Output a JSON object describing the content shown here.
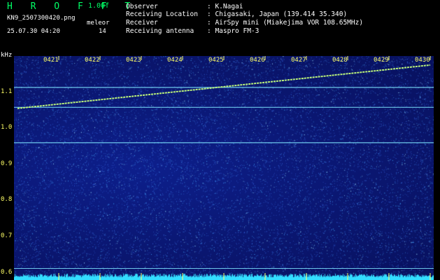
{
  "header": {
    "title": "H R O F F T",
    "version": "1.00f",
    "filename": "KN9_2507300420.png",
    "mode": "meleor",
    "datetime": "25.07.30 04:20",
    "count": "14",
    "info": [
      {
        "label": "Observer",
        "value": ": K.Nagai"
      },
      {
        "label": "Receiving Location",
        "value": ": Chigasaki, Japan (139.414 35.340)"
      },
      {
        "label": "Receiver",
        "value": ": AirSpy mini (Miakejima VOR 108.65MHz)"
      },
      {
        "label": "Receiving antenna",
        "value": ": Maspro FM-3"
      }
    ]
  },
  "colors": {
    "background": "#0a1670",
    "label_yellow": "#ffff66",
    "title_green": "#00ff66",
    "carrier_line": "#7fe6ff",
    "noise_floor": "#33ddff"
  },
  "chart_data": {
    "type": "heatmap",
    "ylabel": "kHz",
    "x_ticks": [
      "0421",
      "0422",
      "0423",
      "0424",
      "0425",
      "0426",
      "0427",
      "0428",
      "0429",
      "0430"
    ],
    "y_ticks": [
      "1.1",
      "1.0",
      "0.9",
      "0.8",
      "0.7",
      "0.6"
    ],
    "ylim": [
      0.58,
      1.2
    ],
    "horizontal_lines_khz": [
      1.113,
      1.058,
      0.96,
      0.612
    ],
    "meteor_trace": {
      "start": {
        "time": "0420",
        "khz": 1.055
      },
      "end": {
        "time": "0430",
        "khz": 1.175
      }
    }
  }
}
